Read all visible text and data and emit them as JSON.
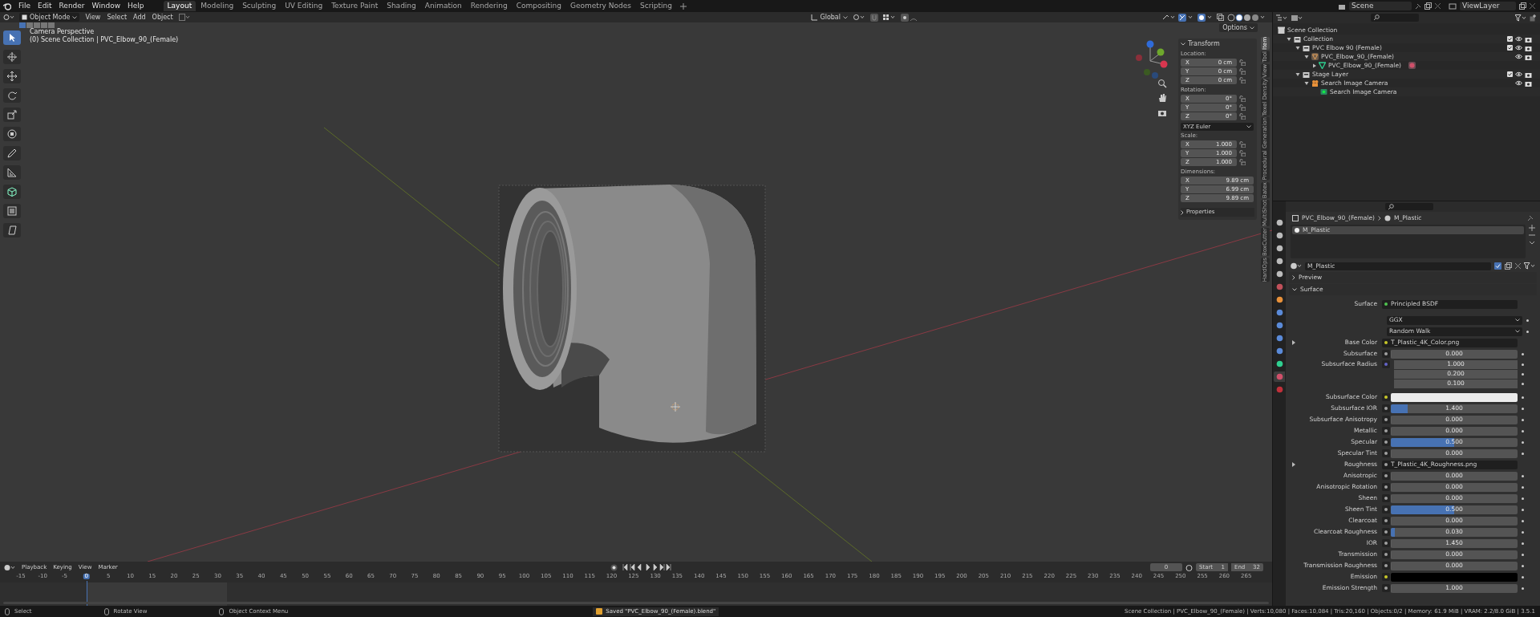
{
  "menu": [
    "File",
    "Edit",
    "Render",
    "Window",
    "Help"
  ],
  "workspaces": [
    {
      "label": "Layout",
      "selected": true
    },
    {
      "label": "Modeling",
      "selected": false
    },
    {
      "label": "Sculpting",
      "selected": false
    },
    {
      "label": "UV Editing",
      "selected": false
    },
    {
      "label": "Texture Paint",
      "selected": false
    },
    {
      "label": "Shading",
      "selected": false
    },
    {
      "label": "Animation",
      "selected": false
    },
    {
      "label": "Rendering",
      "selected": false
    },
    {
      "label": "Compositing",
      "selected": false
    },
    {
      "label": "Geometry Nodes",
      "selected": false
    },
    {
      "label": "Scripting",
      "selected": false
    }
  ],
  "scene": "Scene",
  "view_layer": "ViewLayer",
  "viewport": {
    "mode": "Object Mode",
    "menus": [
      "View",
      "Select",
      "Add",
      "Object"
    ],
    "orientation": "Global",
    "options": "Options",
    "info": [
      "Camera Perspective",
      "(0) Scene Collection | PVC_Elbow_90_(Female)"
    ],
    "tools": [
      {
        "kind": "select",
        "selected": true
      },
      {
        "kind": "cursor",
        "selected": false
      },
      {
        "kind": "move",
        "selected": false
      },
      {
        "kind": "rotate",
        "selected": false
      },
      {
        "kind": "scale",
        "selected": false
      },
      {
        "kind": "transform",
        "selected": false
      },
      {
        "kind": "annotate",
        "selected": false
      },
      {
        "kind": "measure",
        "selected": false
      },
      {
        "kind": "add_cube",
        "selected": false
      },
      {
        "kind": "box",
        "selected": false
      },
      {
        "kind": "shear",
        "selected": false
      }
    ]
  },
  "sidebar": {
    "tabs": [
      {
        "label": "Item",
        "selected": true
      },
      {
        "label": "Tool",
        "selected": false
      },
      {
        "label": "View",
        "selected": false
      },
      {
        "label": "Texel Density",
        "selected": false
      },
      {
        "label": "Procedural Generation",
        "selected": false
      },
      {
        "label": "Batex",
        "selected": false
      },
      {
        "label": "MultiShot",
        "selected": false
      },
      {
        "label": "BoxCutter",
        "selected": false
      },
      {
        "label": "HardOps",
        "selected": false
      }
    ],
    "transform": {
      "title": "Transform",
      "groups": [
        {
          "label": "Location:",
          "rows": [
            {
              "axis": "X",
              "value": "0 cm"
            },
            {
              "axis": "Y",
              "value": "0 cm"
            },
            {
              "axis": "Z",
              "value": "0 cm"
            }
          ],
          "locks": true
        },
        {
          "label": "Rotation:",
          "rows": [
            {
              "axis": "X",
              "value": "0°"
            },
            {
              "axis": "Y",
              "value": "0°"
            },
            {
              "axis": "Z",
              "value": "0°"
            }
          ],
          "locks": true,
          "mode": "XYZ Euler"
        },
        {
          "label": "Scale:",
          "rows": [
            {
              "axis": "X",
              "value": "1.000"
            },
            {
              "axis": "Y",
              "value": "1.000"
            },
            {
              "axis": "Z",
              "value": "1.000"
            }
          ],
          "locks": true
        },
        {
          "label": "Dimensions:",
          "rows": [
            {
              "axis": "X",
              "value": "9.89 cm"
            },
            {
              "axis": "Y",
              "value": "6.99 cm"
            },
            {
              "axis": "Z",
              "value": "9.89 cm"
            }
          ],
          "locks": false
        }
      ]
    },
    "properties_panel": "Properties"
  },
  "outliner": {
    "items": [
      {
        "name": "Scene Collection",
        "kind": "scene_collection",
        "children": [
          {
            "name": "Collection",
            "kind": "collection",
            "expanded": true,
            "children": [
              {
                "name": "PVC Elbow 90 (Female)",
                "kind": "collection",
                "expanded": true,
                "children": [
                  {
                    "name": "PVC_Elbow_90_(Female)",
                    "kind": "empty",
                    "expanded": true,
                    "children": [
                      {
                        "name": "PVC_Elbow_90_(Female)",
                        "kind": "mesh",
                        "expanded": false
                      }
                    ]
                  }
                ]
              },
              {
                "name": "Stage Layer",
                "kind": "collection",
                "expanded": true,
                "children": [
                  {
                    "name": "Search Image Camera",
                    "kind": "camera",
                    "expanded": true,
                    "children": [
                      {
                        "name": "Search Image Camera",
                        "kind": "camera_data"
                      }
                    ]
                  }
                ]
              }
            ]
          }
        ]
      }
    ]
  },
  "properties": {
    "tabs": [
      {
        "kind": "tool",
        "selected": false
      },
      {
        "kind": "render",
        "selected": false
      },
      {
        "kind": "output",
        "selected": false
      },
      {
        "kind": "view_layer",
        "selected": false
      },
      {
        "kind": "scene",
        "selected": false
      },
      {
        "kind": "world",
        "selected": false
      },
      {
        "kind": "object",
        "selected": false
      },
      {
        "kind": "modifiers",
        "selected": false
      },
      {
        "kind": "particles",
        "selected": false
      },
      {
        "kind": "physics",
        "selected": false
      },
      {
        "kind": "constraints",
        "selected": false
      },
      {
        "kind": "data",
        "selected": false
      },
      {
        "kind": "material",
        "selected": true
      },
      {
        "kind": "texture",
        "selected": false
      }
    ],
    "breadcrumb": [
      "PVC_Elbow_90_(Female)",
      "M_Plastic"
    ],
    "slots": [
      "M_Plastic"
    ],
    "material": "M_Plastic",
    "panels": [
      {
        "title": "Preview",
        "expanded": false
      },
      {
        "title": "Surface",
        "expanded": true
      }
    ],
    "surface": {
      "label": "Surface",
      "value": "Principled BSDF",
      "color": "#4fc34f"
    },
    "dropdowns": [
      "GGX",
      "Random Walk"
    ],
    "inputs": [
      {
        "label": "Base Color",
        "kind": "link",
        "value": "T_Plastic_4K_Color.png",
        "color": "#c7c729",
        "expanded": false
      },
      {
        "label": "Subsurface",
        "kind": "number",
        "value": "0.000",
        "level": 0,
        "color": "#a1a1a1"
      },
      {
        "label": "Subsurface Radius",
        "kind": "vector",
        "values": [
          "1.000",
          "0.200",
          "0.100"
        ],
        "color": "#6363c7"
      },
      {
        "label": "Subsurface Color",
        "kind": "color",
        "swatch": {
          "color": "#ececec"
        },
        "color": "#c7c729"
      },
      {
        "label": "Subsurface IOR",
        "kind": "number",
        "value": "1.400",
        "level": 0.13,
        "color": "#a1a1a1"
      },
      {
        "label": "Subsurface Anisotropy",
        "kind": "number",
        "value": "0.000",
        "level": 0,
        "color": "#a1a1a1"
      },
      {
        "label": "Metallic",
        "kind": "number",
        "value": "0.000",
        "level": 0,
        "color": "#a1a1a1"
      },
      {
        "label": "Specular",
        "kind": "number",
        "value": "0.500",
        "level": 0.5,
        "color": "#a1a1a1"
      },
      {
        "label": "Specular Tint",
        "kind": "number",
        "value": "0.000",
        "level": 0,
        "color": "#a1a1a1"
      },
      {
        "label": "Roughness",
        "kind": "link",
        "value": "T_Plastic_4K_Roughness.png",
        "color": "#a1a1a1",
        "expanded": false
      },
      {
        "label": "Anisotropic",
        "kind": "number",
        "value": "0.000",
        "level": 0,
        "color": "#a1a1a1"
      },
      {
        "label": "Anisotropic Rotation",
        "kind": "number",
        "value": "0.000",
        "level": 0,
        "color": "#a1a1a1"
      },
      {
        "label": "Sheen",
        "kind": "number",
        "value": "0.000",
        "level": 0,
        "color": "#a1a1a1"
      },
      {
        "label": "Sheen Tint",
        "kind": "number",
        "value": "0.500",
        "level": 0.5,
        "color": "#a1a1a1"
      },
      {
        "label": "Clearcoat",
        "kind": "number",
        "value": "0.000",
        "level": 0,
        "color": "#a1a1a1"
      },
      {
        "label": "Clearcoat Roughness",
        "kind": "number",
        "value": "0.030",
        "level": 0.03,
        "color": "#a1a1a1"
      },
      {
        "label": "IOR",
        "kind": "number",
        "value": "1.450",
        "level": 0,
        "color": "#a1a1a1"
      },
      {
        "label": "Transmission",
        "kind": "number",
        "value": "0.000",
        "level": 0,
        "color": "#a1a1a1"
      },
      {
        "label": "Transmission Roughness",
        "kind": "number",
        "value": "0.000",
        "level": 0,
        "color": "#a1a1a1"
      },
      {
        "label": "Emission",
        "kind": "color",
        "swatch": {
          "color": "#000000"
        },
        "color": "#c7c729"
      },
      {
        "label": "Emission Strength",
        "kind": "number",
        "value": "1.000",
        "level": 0,
        "color": "#a1a1a1"
      }
    ]
  },
  "timeline": {
    "menus": [
      "Playback",
      "Keying",
      "View",
      "Marker"
    ],
    "current_frame": "0",
    "start_label": "Start",
    "start": "1",
    "end_label": "End",
    "end": "32",
    "ticks": [
      {
        "label": "-15",
        "selected": false
      },
      {
        "label": "-10",
        "selected": false
      },
      {
        "label": "-5",
        "selected": false
      },
      {
        "label": "0",
        "selected": true
      },
      {
        "label": "5",
        "selected": false
      },
      {
        "label": "10",
        "selected": false
      },
      {
        "label": "15",
        "selected": false
      },
      {
        "label": "20",
        "selected": false
      },
      {
        "label": "25",
        "selected": false
      },
      {
        "label": "30",
        "selected": false
      },
      {
        "label": "35",
        "selected": false
      },
      {
        "label": "40",
        "selected": false
      },
      {
        "label": "45",
        "selected": false
      },
      {
        "label": "50",
        "selected": false
      },
      {
        "label": "55",
        "selected": false
      },
      {
        "label": "60",
        "selected": false
      },
      {
        "label": "65",
        "selected": false
      },
      {
        "label": "70",
        "selected": false
      },
      {
        "label": "75",
        "selected": false
      },
      {
        "label": "80",
        "selected": false
      },
      {
        "label": "85",
        "selected": false
      },
      {
        "label": "90",
        "selected": false
      },
      {
        "label": "95",
        "selected": false
      },
      {
        "label": "100",
        "selected": false
      },
      {
        "label": "105",
        "selected": false
      },
      {
        "label": "110",
        "selected": false
      },
      {
        "label": "115",
        "selected": false
      },
      {
        "label": "120",
        "selected": false
      },
      {
        "label": "125",
        "selected": false
      },
      {
        "label": "130",
        "selected": false
      },
      {
        "label": "135",
        "selected": false
      },
      {
        "label": "140",
        "selected": false
      },
      {
        "label": "145",
        "selected": false
      },
      {
        "label": "150",
        "selected": false
      },
      {
        "label": "155",
        "selected": false
      },
      {
        "label": "160",
        "selected": false
      },
      {
        "label": "165",
        "selected": false
      },
      {
        "label": "170",
        "selected": false
      },
      {
        "label": "175",
        "selected": false
      },
      {
        "label": "180",
        "selected": false
      },
      {
        "label": "185",
        "selected": false
      },
      {
        "label": "190",
        "selected": false
      },
      {
        "label": "195",
        "selected": false
      },
      {
        "label": "200",
        "selected": false
      },
      {
        "label": "205",
        "selected": false
      },
      {
        "label": "210",
        "selected": false
      },
      {
        "label": "215",
        "selected": false
      },
      {
        "label": "220",
        "selected": false
      },
      {
        "label": "225",
        "selected": false
      },
      {
        "label": "230",
        "selected": false
      },
      {
        "label": "235",
        "selected": false
      },
      {
        "label": "240",
        "selected": false
      },
      {
        "label": "245",
        "selected": false
      },
      {
        "label": "250",
        "selected": false
      },
      {
        "label": "255",
        "selected": false
      },
      {
        "label": "260",
        "selected": false
      },
      {
        "label": "265",
        "selected": false
      }
    ]
  },
  "status_bar": {
    "hints": [
      "Select",
      "Rotate View",
      "Object Context Menu"
    ],
    "message": "Saved \"PVC_Elbow_90_(Female).blend\"",
    "stats": "Scene Collection | PVC_Elbow_90_(Female) | Verts:10,080 | Faces:10,084 | Tris:20,160 | Objects:0/2 | Memory: 61.9 MiB | VRAM: 2.2/8.0 GiB | 3.5.1"
  }
}
